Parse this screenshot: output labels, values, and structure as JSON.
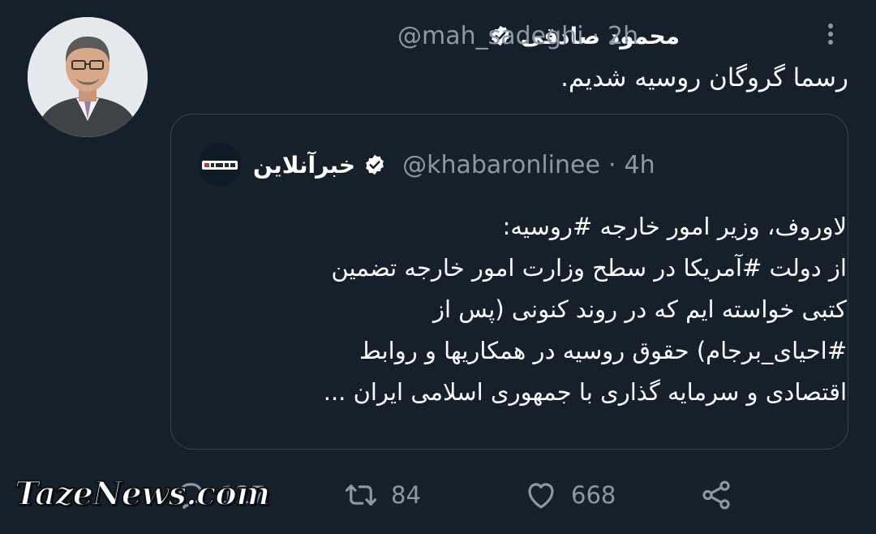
{
  "tweet": {
    "author_name": "محمود صادقی",
    "handle": "@mah_sadeghi",
    "separator": "·",
    "time": "2h",
    "text": "رسما گروگان روسیه شدیم.",
    "icons": {
      "verified": "verified-badge-icon",
      "more": "more-options-icon",
      "avatar": "profile-photo"
    }
  },
  "quote": {
    "author_name": "خبرآنلاین",
    "handle": "@khabaronlinee",
    "separator": "·",
    "time": "4h",
    "logo_text": "خبرآنلاین",
    "lines": [
      "لاوروف، وزیر امور خارجه #روسیه:",
      "از دولت #آمریکا در سطح وزارت امور خارجه تضمین",
      "کتبی خواسته ایم که در روند کنونی (پس از",
      "#احیای_برجام) حقوق روسیه در همکاریها و روابط",
      "اقتصادی و سرمایه گذاری با جمهوری اسلامی ایران ..."
    ]
  },
  "actions": {
    "reply_count": "127",
    "retweet_count": "84",
    "like_count": "668",
    "icons": [
      "reply-icon",
      "retweet-icon",
      "like-icon",
      "share-icon"
    ]
  },
  "watermark": "TazeNews.com",
  "colors": {
    "background": "#15202b",
    "secondary_text": "#8b98a5",
    "border": "#38444d",
    "primary_text": "#ffffff"
  }
}
